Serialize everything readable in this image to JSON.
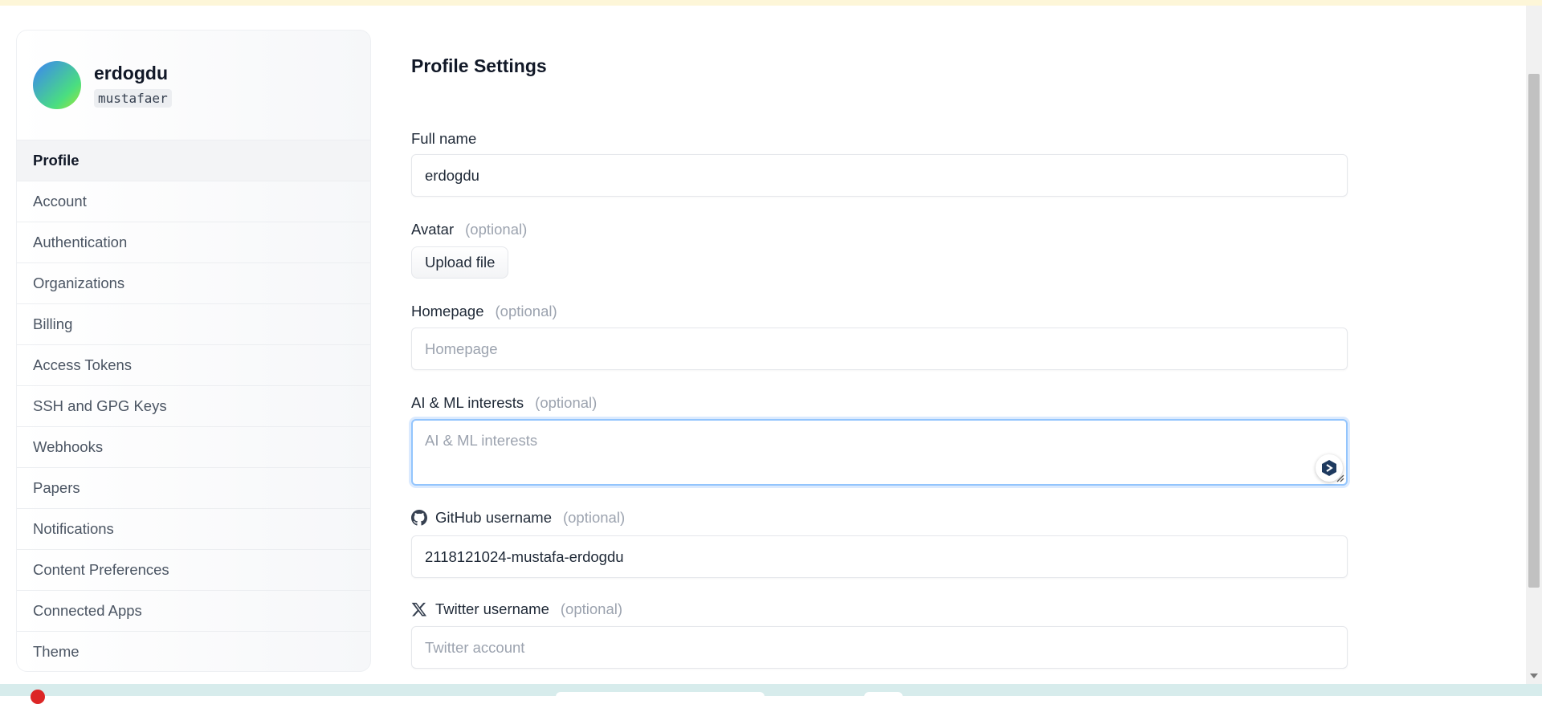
{
  "sidebar": {
    "user": {
      "display_name": "erdogdu",
      "username": "mustafaer"
    },
    "items": [
      {
        "label": "Profile",
        "active": true
      },
      {
        "label": "Account"
      },
      {
        "label": "Authentication"
      },
      {
        "label": "Organizations"
      },
      {
        "label": "Billing"
      },
      {
        "label": "Access Tokens"
      },
      {
        "label": "SSH and GPG Keys"
      },
      {
        "label": "Webhooks"
      },
      {
        "label": "Papers"
      },
      {
        "label": "Notifications"
      },
      {
        "label": "Content Preferences"
      },
      {
        "label": "Connected Apps"
      },
      {
        "label": "Theme"
      }
    ]
  },
  "main": {
    "title": "Profile Settings",
    "optional_text": "(optional)",
    "full_name": {
      "label": "Full name",
      "value": "erdogdu"
    },
    "avatar": {
      "label": "Avatar",
      "button_label": "Upload file"
    },
    "homepage": {
      "label": "Homepage",
      "placeholder": "Homepage",
      "value": ""
    },
    "interests": {
      "label": "AI & ML interests",
      "placeholder": "AI & ML interests",
      "value": "",
      "focused": true
    },
    "github": {
      "label": "GitHub username",
      "icon": "github-icon",
      "value": "2118121024-mustafa-erdogdu"
    },
    "twitter": {
      "label": "Twitter username",
      "icon": "x-icon",
      "placeholder": "Twitter account",
      "value": ""
    }
  },
  "colors": {
    "accent_focus": "#93c5fd",
    "optional_gray": "#9ca3af",
    "top_banner": "#fdf6d8",
    "taskbar": "#d7ecec"
  }
}
